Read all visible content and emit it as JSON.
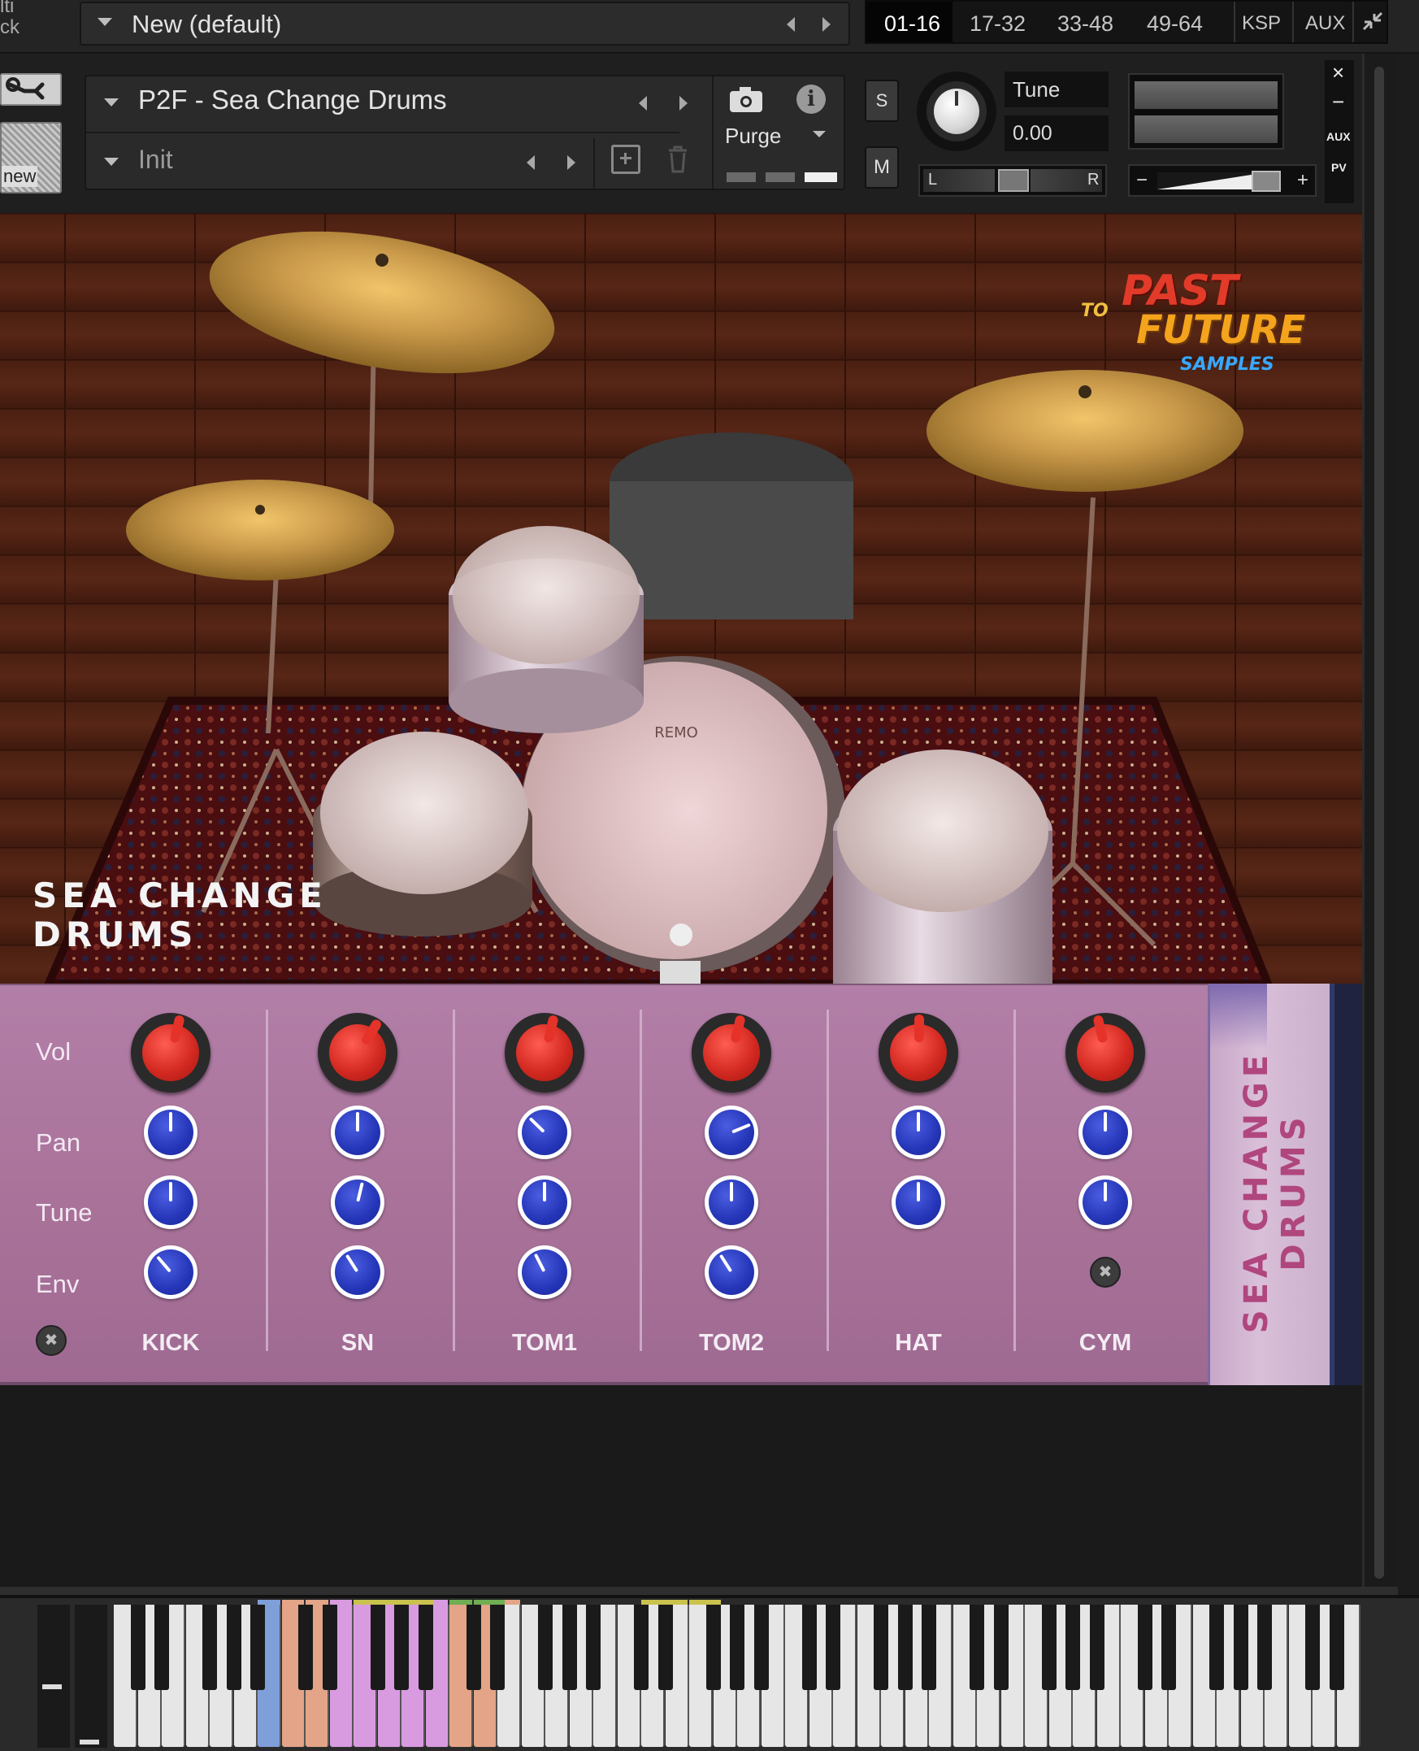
{
  "multi": {
    "label_top": "lti",
    "label_bottom": "ck",
    "preset_name": "New (default)",
    "tabs": [
      {
        "label": "01-16",
        "active": true
      },
      {
        "label": "17-32",
        "active": false
      },
      {
        "label": "33-48",
        "active": false
      },
      {
        "label": "49-64",
        "active": false
      },
      {
        "label": "KSP",
        "active": false
      },
      {
        "label": "AUX",
        "active": false
      }
    ]
  },
  "instrument": {
    "name": "P2F - Sea Change Drums",
    "snapshot": "Init",
    "new_label": "new",
    "purge_label": "Purge",
    "solo_label": "S",
    "mute_label": "M",
    "tune_label": "Tune",
    "tune_value": "0.00",
    "pan_left": "L",
    "pan_right": "R",
    "volume_minus": "−",
    "volume_plus": "+",
    "side_close": "×",
    "side_min": "−",
    "side_aux": "AUX",
    "side_pv": "PV"
  },
  "scene": {
    "title_line1": "SEA CHANGE",
    "title_line2": "DRUMS",
    "logo_line1": "PAST",
    "logo_to": "TO",
    "logo_line2": "FUTURE",
    "logo_line3": "SAMPLES",
    "bass_drum_brand": "REMO"
  },
  "mixer": {
    "row_labels": [
      "Vol",
      "Pan",
      "Tune",
      "Env"
    ],
    "channels": [
      {
        "name": "KICK",
        "vol": 0.55,
        "pan": 0.5,
        "tune": 0.5,
        "env": 0.35,
        "has_env": true
      },
      {
        "name": "SN",
        "vol": 0.62,
        "pan": 0.5,
        "tune": 0.55,
        "env": 0.38,
        "has_env": true
      },
      {
        "name": "TOM1",
        "vol": 0.55,
        "pan": 0.33,
        "tune": 0.5,
        "env": 0.4,
        "has_env": true
      },
      {
        "name": "TOM2",
        "vol": 0.55,
        "pan": 0.75,
        "tune": 0.5,
        "env": 0.38,
        "has_env": true
      },
      {
        "name": "HAT",
        "vol": 0.5,
        "pan": 0.5,
        "tune": 0.5,
        "env": null,
        "has_env": false
      },
      {
        "name": "CYM",
        "vol": 0.45,
        "pan": 0.5,
        "tune": 0.5,
        "env": null,
        "has_env": false
      }
    ],
    "side_title_line1": "SEA CHANGE",
    "side_title_line2": "DRUMS"
  },
  "keyboard": {
    "key_colors": {
      "blue": "#7f9fd9",
      "orange": "#e3a487",
      "pink": "#d89be0",
      "olive": "#c9c24d",
      "green": "#6fae52"
    }
  },
  "colors": {
    "panel": "#aa7499",
    "knob_red": "#d42a22",
    "knob_blue": "#2435b8"
  }
}
